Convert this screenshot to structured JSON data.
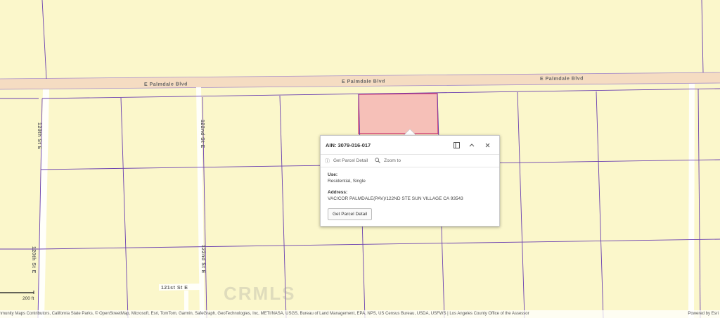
{
  "map": {
    "colors": {
      "land": "#fbf7cb",
      "parcel_line": "#6a3fb0",
      "selected_fill": "#f6c0b8",
      "selected_stroke": "#d2326e",
      "road_fill": "#f5dcc2",
      "local_road": "#ffffff"
    },
    "roads": [
      {
        "name": "E Palmdale Blvd"
      },
      {
        "name": "E Palmdale Blvd"
      },
      {
        "name": "E Palmdale Blvd"
      },
      {
        "name": "120th St E"
      },
      {
        "name": "120th St E"
      },
      {
        "name": "122nd St E"
      },
      {
        "name": "122nd St E"
      },
      {
        "name": "121st St E"
      }
    ],
    "watermark": "CRMLS"
  },
  "popup": {
    "title": "AIN: 3079-016-017",
    "dock_icon": "dock-icon",
    "collapse_icon": "chevron-up-icon",
    "close_icon": "close-icon",
    "actions": [
      {
        "label": "Get Parcel Detail",
        "icon": "info-icon"
      },
      {
        "label": "Zoom to",
        "icon": "zoom-icon"
      }
    ],
    "fields": [
      {
        "label": "Use:",
        "value": "Residential, Single"
      },
      {
        "label": "Address:",
        "value": "VAC/COR PALMDALE(PAV)/122ND STE SUN VILLAGE CA 93543"
      }
    ],
    "button_label": "Get Parcel Detail"
  },
  "scalebar": {
    "label": "200 ft"
  },
  "attribution": {
    "text": "mmunity Maps Contributors, California State Parks, © OpenStreetMap, Microsoft, Esri, TomTom, Garmin, SafeGraph, GeoTechnologies, Inc, METI/NASA, USGS, Bureau of Land Management, EPA, NPS, US Census Bureau, USDA, USFWS | Los Angeles County Office of the Assessor",
    "powered": "Powered by Esri"
  }
}
